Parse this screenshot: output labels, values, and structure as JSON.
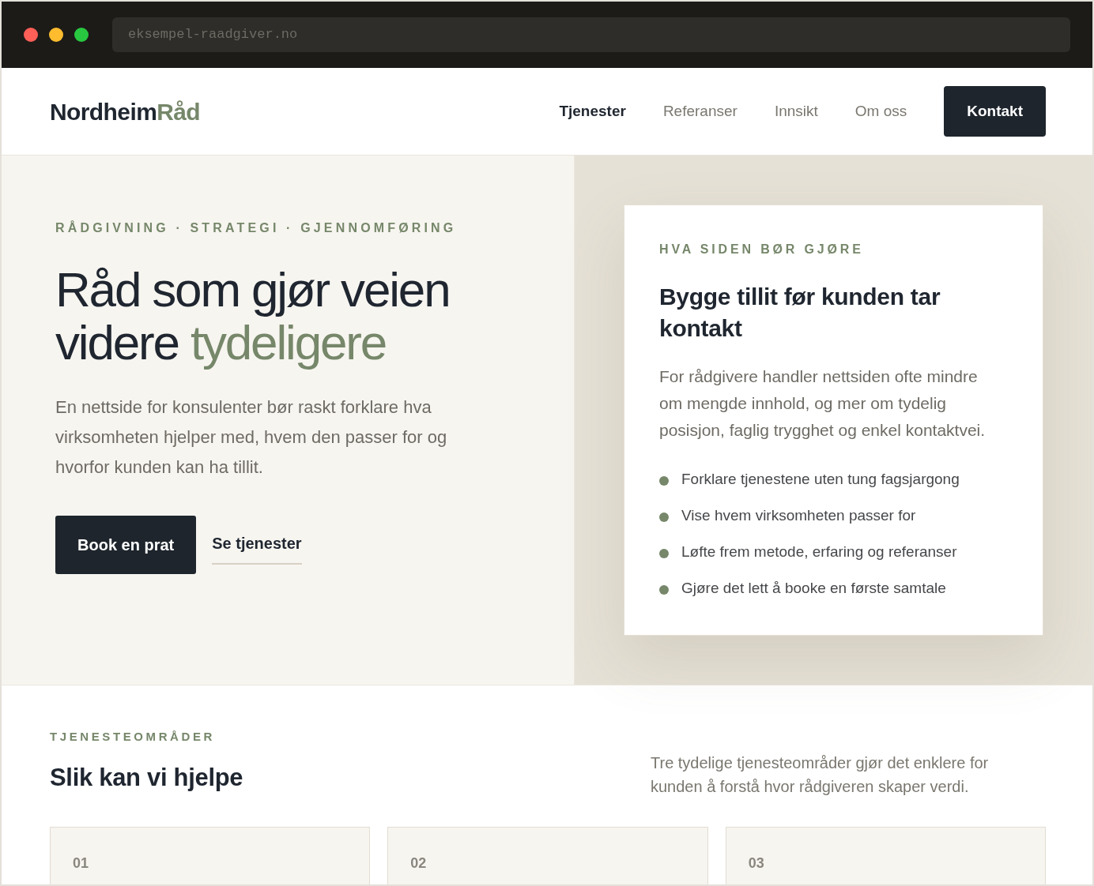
{
  "browser": {
    "url": "eksempel-raadgiver.no"
  },
  "header": {
    "logo": {
      "primary": "Nordheim",
      "accent": "Råd"
    },
    "nav": [
      {
        "label": "Tjenester",
        "selected": true
      },
      {
        "label": "Referanser",
        "selected": false
      },
      {
        "label": "Innsikt",
        "selected": false
      },
      {
        "label": "Om oss",
        "selected": false
      }
    ],
    "cta": "Kontakt"
  },
  "hero": {
    "eyebrow": "RÅDGIVNING · STRATEGI · GJENNOMFØRING",
    "headline": "Råd som gjør veien videre",
    "headline_accent": "tydeligere",
    "lead": "En nettside for konsulenter bør raskt forklare hva virksomheten hjelper med, hvem den passer for og hvorfor kunden kan ha tillit.",
    "primary_button": "Book en prat",
    "secondary_link": "Se tjenester"
  },
  "card": {
    "eyebrow": "HVA SIDEN BØR GJØRE",
    "title": "Bygge tillit før kunden tar kontakt",
    "body": "For rådgivere handler nettsiden ofte mindre om mengde innhold, og mer om tydelig posisjon, faglig trygghet og enkel kontaktvei.",
    "points": [
      "Forklare tjenestene uten tung fagsjargong",
      "Vise hvem virksomheten passer for",
      "Løfte frem metode, erfaring og referanser",
      "Gjøre det lett å booke en første samtale"
    ]
  },
  "services": {
    "eyebrow": "TJENESTEOMRÅDER",
    "title": "Slik kan vi hjelpe",
    "intro": "Tre tydelige tjenesteområder gjør det enklere for kunden å forstå hvor rådgiveren skaper verdi.",
    "items": [
      {
        "number": "01"
      },
      {
        "number": "02"
      },
      {
        "number": "03"
      }
    ]
  }
}
